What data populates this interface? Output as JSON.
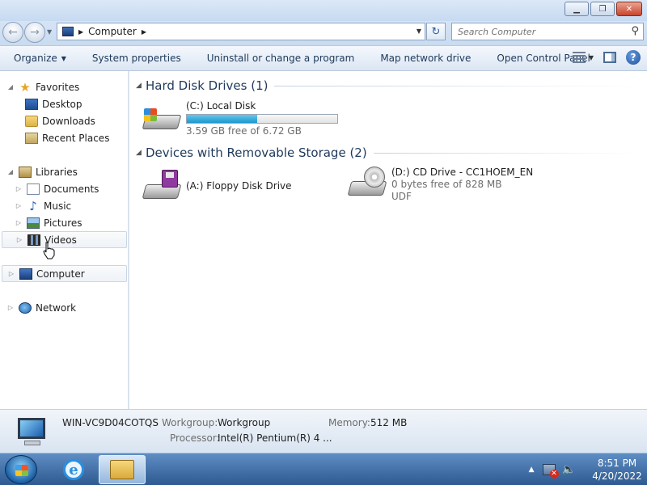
{
  "window": {
    "minimize_icon": "minimize-icon",
    "maximize_icon": "restore-icon",
    "close_icon": "close-icon"
  },
  "address_bar": {
    "location": "Computer",
    "search_placeholder": "Search Computer"
  },
  "command_bar": {
    "organize": "Organize",
    "system_properties": "System properties",
    "uninstall": "Uninstall or change a program",
    "map_network": "Map network drive",
    "control_panel": "Open Control Panel"
  },
  "nav_pane": {
    "favorites": "Favorites",
    "desktop": "Desktop",
    "downloads": "Downloads",
    "recent_places": "Recent Places",
    "libraries": "Libraries",
    "documents": "Documents",
    "music": "Music",
    "pictures": "Pictures",
    "videos": "Videos",
    "computer": "Computer",
    "network": "Network",
    "selected": "videos"
  },
  "content": {
    "groups": [
      {
        "title": "Hard Disk Drives (1)",
        "drives": [
          {
            "name": "(C:) Local Disk",
            "free_text": "3.59 GB free of 6.72 GB",
            "used_fraction": 0.466
          }
        ]
      },
      {
        "title": "Devices with Removable Storage (2)",
        "drives": [
          {
            "name": "(A:) Floppy Disk Drive"
          },
          {
            "name": "(D:) CD Drive - CC1HOEM_EN",
            "free_text": "0 bytes free of 828 MB",
            "filesystem": "UDF"
          }
        ]
      }
    ]
  },
  "details": {
    "computer_name": "WIN-VC9D04COTQS",
    "workgroup_label": "Workgroup:",
    "workgroup": "Workgroup",
    "memory_label": "Memory:",
    "memory": "512 MB",
    "processor_label": "Processor:",
    "processor": "Intel(R) Pentium(R) 4   ..."
  },
  "taskbar": {
    "time": "8:51 PM",
    "date": "4/20/2022"
  }
}
